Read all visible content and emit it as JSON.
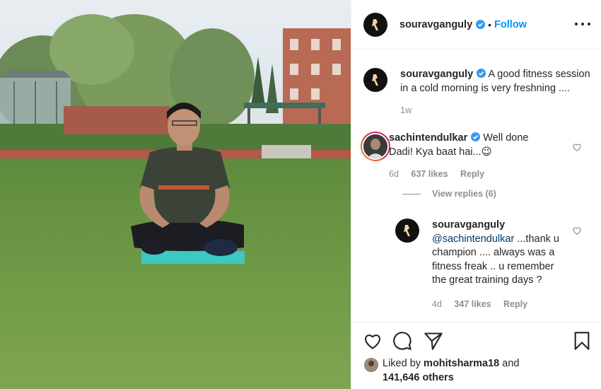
{
  "post": {
    "author": "souravganguly",
    "follow_label": "Follow",
    "dot": "•"
  },
  "caption": {
    "username": "souravganguly",
    "text": "A good fitness session in a cold morning is very freshning ....",
    "time": "1w"
  },
  "comments": [
    {
      "username": "sachintendulkar",
      "text": "Well done Dadi! Kya baat hai...",
      "emoji": "😉",
      "time": "6d",
      "likes": "637 likes",
      "reply_label": "Reply",
      "view_replies": "View replies (6)"
    },
    {
      "username": "souravganguly",
      "mention": "@sachintendulkar",
      "text": " ...thank u champion .... always was a fitness freak .. u remember the great training days ?",
      "time": "4d",
      "likes": "347 likes",
      "reply_label": "Reply"
    }
  ],
  "footer": {
    "liked_by_prefix": "Liked by",
    "liked_by_user": "mohitsharma18",
    "and": "and",
    "others": "141,646 others"
  },
  "colors": {
    "link_blue": "#0095f6",
    "verified_blue": "#3897f0",
    "meta_gray": "#8e8e8e"
  },
  "icons": [
    "verified-badge-icon",
    "more-options-icon",
    "heart-icon",
    "comment-icon",
    "share-icon",
    "bookmark-icon"
  ]
}
